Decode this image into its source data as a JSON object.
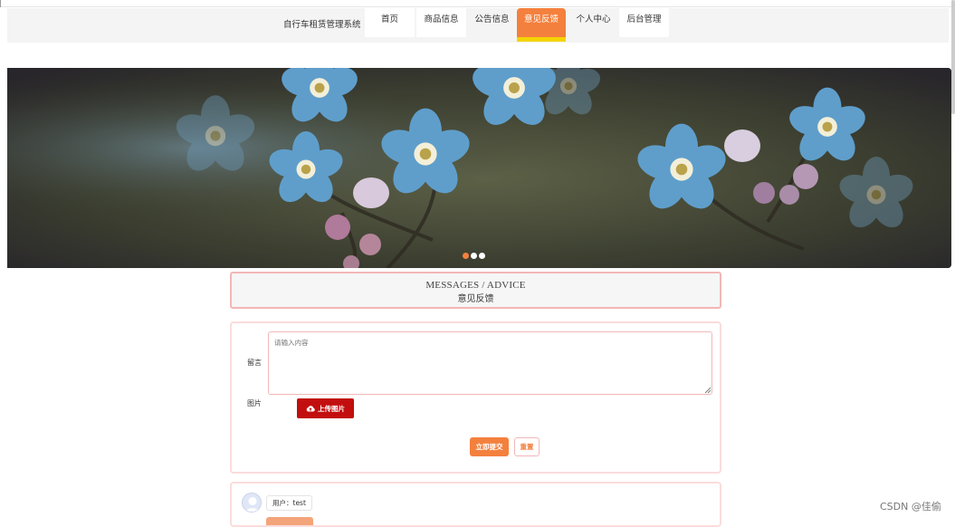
{
  "nav": {
    "brand": "自行车租赁管理系统",
    "items": [
      {
        "label": "首页"
      },
      {
        "label": "商品信息"
      },
      {
        "label": "公告信息"
      },
      {
        "label": "意见反馈"
      },
      {
        "label": "个人中心"
      },
      {
        "label": "后台管理"
      }
    ],
    "active_index": 3
  },
  "banner": {
    "slide_count": 3,
    "active_slide": 0
  },
  "messages": {
    "title_en": "MESSAGES / ADVICE",
    "title_cn": "意见反馈"
  },
  "form": {
    "content_label": "留言",
    "content_placeholder": "请输入内容",
    "image_label": "图片",
    "upload_label": "上传图片",
    "submit_label": "立即提交",
    "reset_label": "重置"
  },
  "comments": [
    {
      "user": "用户：test"
    }
  ],
  "watermark": "CSDN @佳偷",
  "colors": {
    "accent": "#f4803e",
    "active_underline": "#f4d300",
    "upload_button": "#c20e0e",
    "box_border": "#f4b6b6"
  }
}
